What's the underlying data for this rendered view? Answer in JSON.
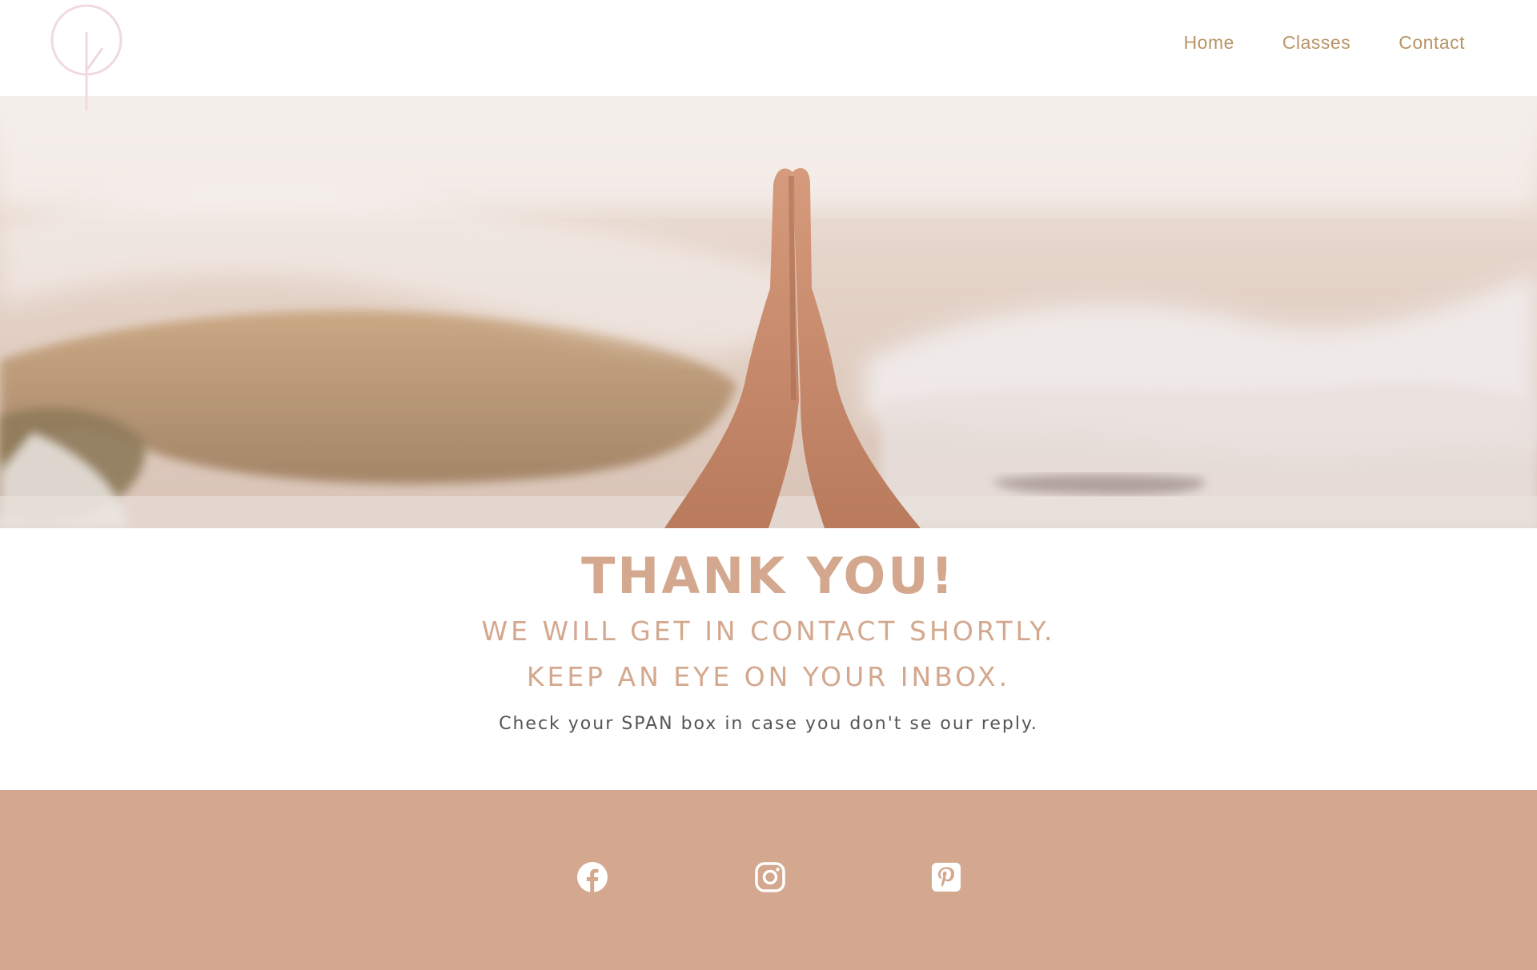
{
  "nav": {
    "items": [
      {
        "label": "Home"
      },
      {
        "label": "Classes"
      },
      {
        "label": "Contact"
      }
    ]
  },
  "thanks": {
    "title": "THANK YOU!",
    "line1": "WE WILL GET IN CONTACT SHORTLY.",
    "line2": "KEEP AN EYE ON YOUR INBOX.",
    "note": "Check your SPAN box in case you don't se our reply."
  },
  "footer": {
    "social": [
      {
        "icon": "facebook-icon"
      },
      {
        "icon": "instagram-icon"
      },
      {
        "icon": "pinterest-icon"
      }
    ]
  },
  "colors": {
    "accent": "#d3a88e",
    "nav_text": "#b99466",
    "logo": "#f0d9df",
    "footer_bg": "#d3a88e"
  }
}
